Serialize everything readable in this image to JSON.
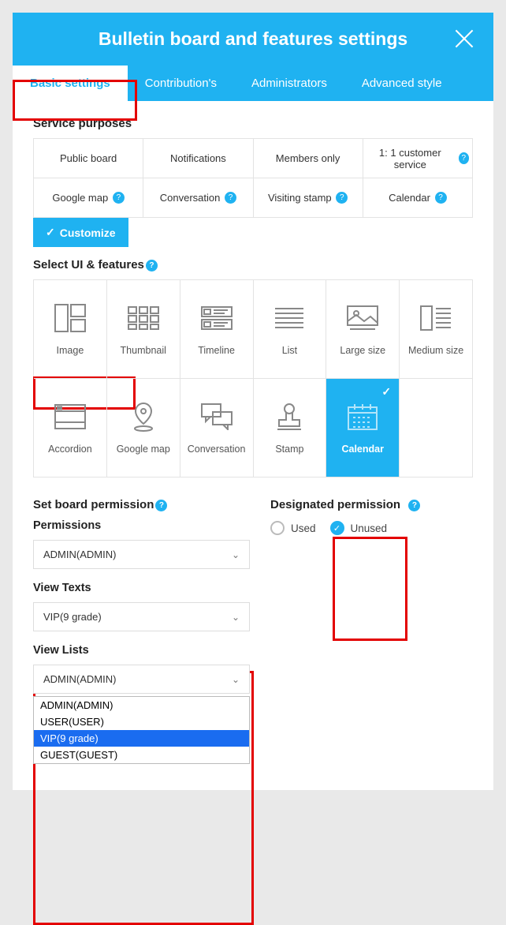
{
  "header": {
    "title": "Bulletin board and features settings"
  },
  "tabs": [
    "Basic settings",
    "Contribution's",
    "Administrators",
    "Advanced style"
  ],
  "active_tab": 0,
  "service_purposes": {
    "label": "Service purposes",
    "items": [
      {
        "label": "Public board",
        "help": false
      },
      {
        "label": "Notifications",
        "help": false
      },
      {
        "label": "Members only",
        "help": false
      },
      {
        "label": "1: 1 customer service",
        "help": true
      },
      {
        "label": "Google map",
        "help": true
      },
      {
        "label": "Conversation",
        "help": true
      },
      {
        "label": "Visiting stamp",
        "help": true
      },
      {
        "label": "Calendar",
        "help": true
      }
    ],
    "customize_label": "Customize"
  },
  "ui_features": {
    "label": "Select UI & features",
    "items": [
      {
        "label": "Image",
        "icon": "layout"
      },
      {
        "label": "Thumbnail",
        "icon": "grid"
      },
      {
        "label": "Timeline",
        "icon": "timeline"
      },
      {
        "label": "List",
        "icon": "lines"
      },
      {
        "label": "Large size",
        "icon": "image"
      },
      {
        "label": "Medium size",
        "icon": "split"
      },
      {
        "label": "Accordion",
        "icon": "accordion"
      },
      {
        "label": "Google map",
        "icon": "pin"
      },
      {
        "label": "Conversation",
        "icon": "chat"
      },
      {
        "label": "Stamp",
        "icon": "stamp"
      },
      {
        "label": "Calendar",
        "icon": "calendar",
        "selected": true
      }
    ]
  },
  "board_permission": {
    "label": "Set board permission",
    "groups": [
      {
        "label": "Permissions",
        "value": "ADMIN(ADMIN)"
      },
      {
        "label": "View Texts",
        "value": "VIP(9 grade)"
      },
      {
        "label": "View Lists",
        "value": "ADMIN(ADMIN)"
      }
    ],
    "dropdown_options": [
      "ADMIN(ADMIN)",
      "USER(USER)",
      "VIP(9 grade)",
      "GUEST(GUEST)"
    ],
    "dropdown_highlight": 2
  },
  "designated_permission": {
    "label": "Designated permission",
    "options": [
      "Used",
      "Unused"
    ],
    "selected": 1
  }
}
